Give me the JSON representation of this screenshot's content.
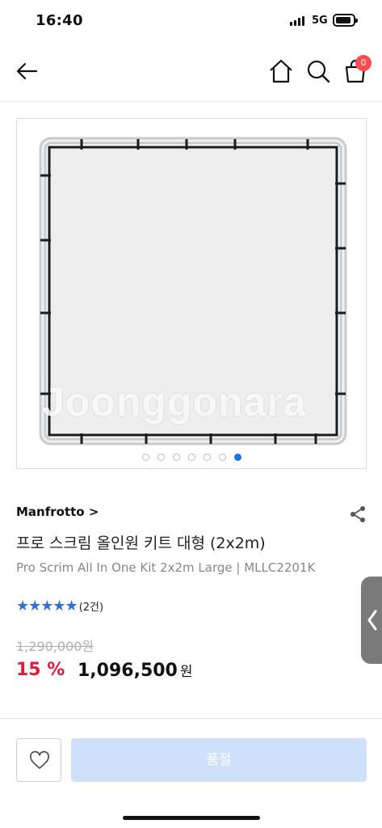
{
  "status_bar": {
    "time": "16:40",
    "network": "5G"
  },
  "header": {
    "cart_count": "0"
  },
  "gallery": {
    "watermark": "Joonggonara",
    "dot_count": 7,
    "active_index": 6
  },
  "product": {
    "brand": "Manfrotto >",
    "title": "프로 스크림 올인원 키트 대형 (2x2m)",
    "subtitle": "Pro Scrim All In One Kit 2x2m Large | MLLC2201K",
    "stars": "★★★★★",
    "review_count": "(2건)",
    "original_price": "1,290,000원",
    "discount": "15 %",
    "price": "1,096,500",
    "currency": "원"
  },
  "actions": {
    "soldout_label": "품절"
  },
  "colors": {
    "accent": "#1a73e8",
    "discount": "#e5193a",
    "soldout_bg": "#cfe0fb",
    "badge": "#ff4d4d"
  }
}
